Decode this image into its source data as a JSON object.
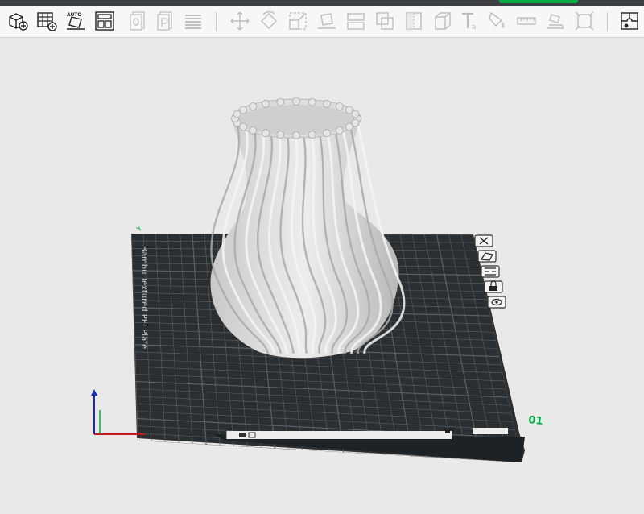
{
  "toolbar": {
    "groups": [
      {
        "items": [
          {
            "name": "add-object-icon",
            "enabled": true
          },
          {
            "name": "add-plate-icon",
            "enabled": true
          },
          {
            "name": "auto-orient-icon",
            "enabled": true,
            "label": "AUTO"
          },
          {
            "name": "arrange-icon",
            "enabled": true
          },
          {
            "name": "copy-icon",
            "enabled": false
          },
          {
            "name": "paste-icon",
            "enabled": false
          },
          {
            "name": "layers-icon",
            "enabled": false
          }
        ]
      },
      {
        "items": [
          {
            "name": "move-icon",
            "enabled": false
          },
          {
            "name": "rotate-icon",
            "enabled": false
          },
          {
            "name": "scale-icon",
            "enabled": false
          },
          {
            "name": "lay-on-face-icon",
            "enabled": false
          },
          {
            "name": "split-icon",
            "enabled": false
          },
          {
            "name": "boolean-icon",
            "enabled": false
          },
          {
            "name": "cut-icon",
            "enabled": false
          },
          {
            "name": "cube-icon",
            "enabled": false
          },
          {
            "name": "text-icon",
            "enabled": false
          },
          {
            "name": "paint-icon",
            "enabled": false
          },
          {
            "name": "measure-icon",
            "enabled": false
          },
          {
            "name": "seam-icon",
            "enabled": false
          },
          {
            "name": "support-icon",
            "enabled": false
          }
        ]
      },
      {
        "items": [
          {
            "name": "assembly-icon",
            "enabled": true
          }
        ]
      }
    ]
  },
  "plate": {
    "name_label": "Bambu Textured PEI Plate",
    "number": "01",
    "axis_label": "Y"
  },
  "colors": {
    "plate": "#2c2f31",
    "grid": "#5c6064",
    "accent": "#00ae42",
    "model": "#d9d9d9"
  }
}
